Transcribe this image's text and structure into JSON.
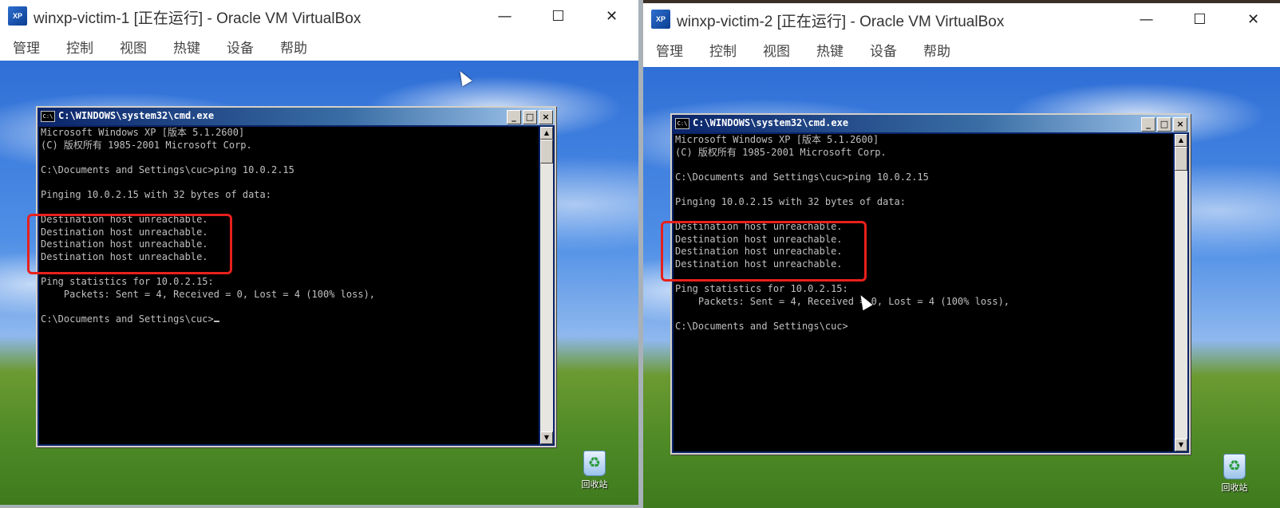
{
  "windows": [
    {
      "title": "winxp-victim-1 [正在运行] - Oracle VM VirtualBox",
      "menu": [
        "管理",
        "控制",
        "视图",
        "热键",
        "设备",
        "帮助"
      ],
      "cmd_title": "C:\\WINDOWS\\system32\\cmd.exe",
      "lines": [
        "Microsoft Windows XP [版本 5.1.2600]",
        "(C) 版权所有 1985-2001 Microsoft Corp.",
        "",
        "C:\\Documents and Settings\\cuc>ping 10.0.2.15",
        "",
        "Pinging 10.0.2.15 with 32 bytes of data:",
        "",
        "Destination host unreachable.",
        "Destination host unreachable.",
        "Destination host unreachable.",
        "Destination host unreachable.",
        "",
        "Ping statistics for 10.0.2.15:",
        "    Packets: Sent = 4, Received = 0, Lost = 4 (100% loss),",
        "",
        "C:\\Documents and Settings\\cuc>"
      ],
      "recycle_label": "回收站"
    },
    {
      "title": "winxp-victim-2 [正在运行] - Oracle VM VirtualBox",
      "menu": [
        "管理",
        "控制",
        "视图",
        "热键",
        "设备",
        "帮助"
      ],
      "cmd_title": "C:\\WINDOWS\\system32\\cmd.exe",
      "lines": [
        "Microsoft Windows XP [版本 5.1.2600]",
        "(C) 版权所有 1985-2001 Microsoft Corp.",
        "",
        "C:\\Documents and Settings\\cuc>ping 10.0.2.15",
        "",
        "Pinging 10.0.2.15 with 32 bytes of data:",
        "",
        "Destination host unreachable.",
        "Destination host unreachable.",
        "Destination host unreachable.",
        "Destination host unreachable.",
        "",
        "Ping statistics for 10.0.2.15:",
        "    Packets: Sent = 4, Received = 0, Lost = 4 (100% loss),",
        "",
        "C:\\Documents and Settings\\cuc>"
      ],
      "recycle_label": "回收站"
    }
  ],
  "window_controls": {
    "minimize": "—",
    "maximize": "☐",
    "close": "✕"
  },
  "colors": {
    "highlight": "#e8201c",
    "console_text": "#c0c0c0",
    "xp_title": "#0a246a"
  },
  "icons": [
    "virtualbox-icon",
    "cmd-icon",
    "recycle-bin-icon",
    "mouse-pointer-icon"
  ]
}
